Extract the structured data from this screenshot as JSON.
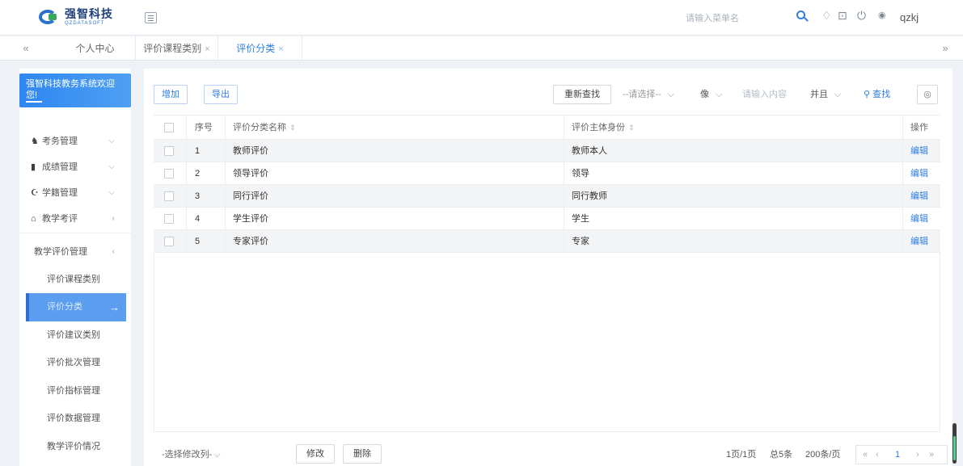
{
  "app": {
    "brand": "强智科技",
    "brand_sub": "QZDATASOFT"
  },
  "header": {
    "search_placeholder": "请输入菜单名",
    "username": "qzkj"
  },
  "tabs": {
    "prev": "«",
    "next": "»",
    "items": [
      {
        "label": "个人中心",
        "close": ""
      },
      {
        "label": "评价课程类别",
        "close": "×"
      },
      {
        "label": "评价分类",
        "close": "×"
      }
    ]
  },
  "sidebar": {
    "welcome": "强智科技教务系统欢迎您!",
    "menus": [
      {
        "label": "考务管理",
        "chev": "⌵"
      },
      {
        "label": "成绩管理",
        "chev": "⌵"
      },
      {
        "label": "学籍管理",
        "chev": "⌵"
      },
      {
        "label": "教学考评",
        "chev": "‹"
      }
    ],
    "group": {
      "label": "教学评价管理",
      "chev": "‹"
    },
    "subitems": [
      "评价课程类别",
      "评价分类",
      "评价建议类别",
      "评价批次管理",
      "评价指标管理",
      "评价数据管理",
      "教学评价情况"
    ],
    "active_arrow": "→"
  },
  "toolbar": {
    "add": "增加",
    "export": "导出",
    "reset": "重新查找",
    "field_select": "--请选择--",
    "operator": "像",
    "query_placeholder": "请输入内容",
    "logic": "并且",
    "search": "查找"
  },
  "table": {
    "headers": {
      "index": "序号",
      "name": "评价分类名称",
      "subject": "评价主体身份",
      "action": "操作"
    },
    "rows": [
      {
        "index": "1",
        "name": "教师评价",
        "subject": "教师本人",
        "action": "编辑"
      },
      {
        "index": "2",
        "name": "领导评价",
        "subject": "领导",
        "action": "编辑"
      },
      {
        "index": "3",
        "name": "同行评价",
        "subject": "同行教师",
        "action": "编辑"
      },
      {
        "index": "4",
        "name": "学生评价",
        "subject": "学生",
        "action": "编辑"
      },
      {
        "index": "5",
        "name": "专家评价",
        "subject": "专家",
        "action": "编辑"
      }
    ]
  },
  "footer": {
    "column_select": "-选择修改列-",
    "modify": "修改",
    "delete": "删除",
    "page_info": "1页/1页",
    "total": "总5条",
    "per_page": "200条/页",
    "current_page": "1"
  },
  "colors": {
    "accent": "#2f7ee0",
    "active_menu": "#5b9ef0",
    "welcome": "#2e86f0"
  }
}
